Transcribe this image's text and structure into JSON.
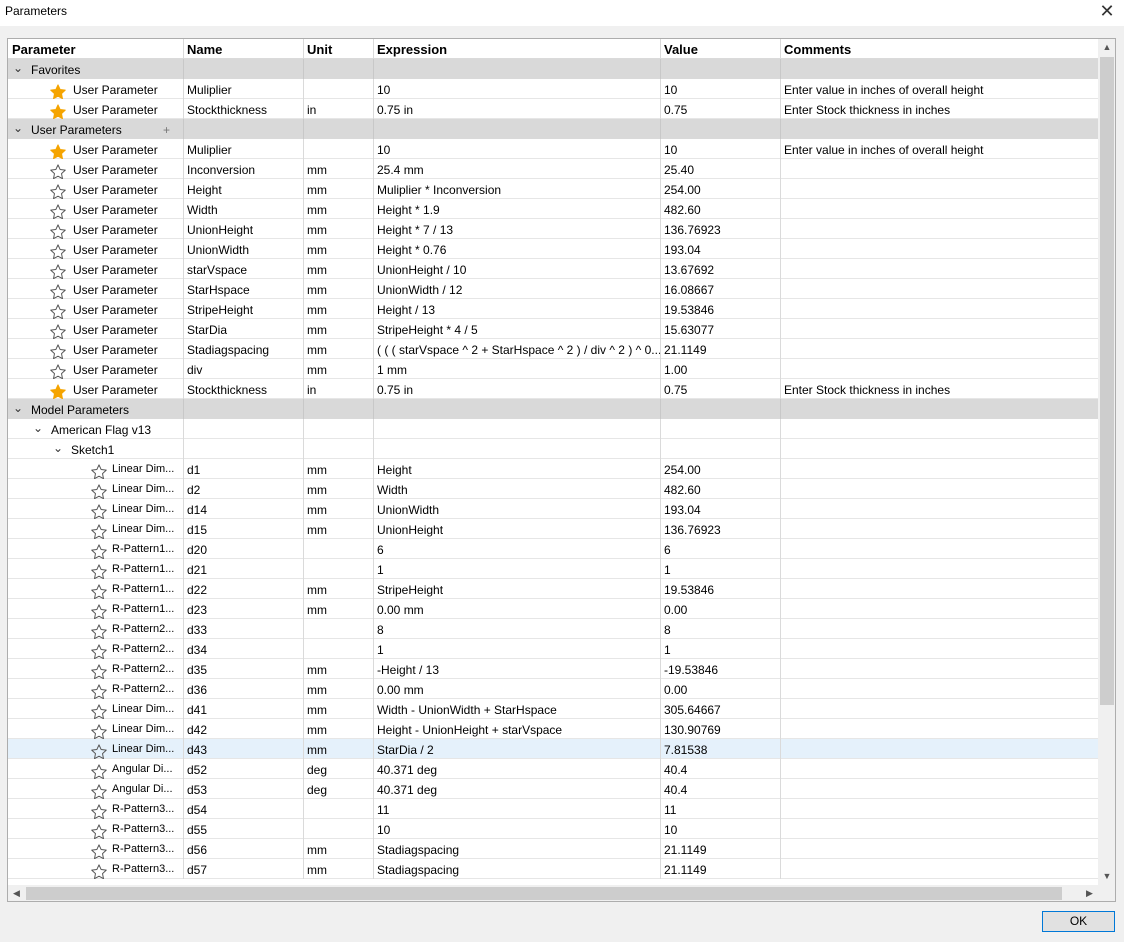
{
  "window": {
    "title": "Parameters"
  },
  "columns": [
    "Parameter",
    "Name",
    "Unit",
    "Expression",
    "Value",
    "Comments"
  ],
  "colors": {
    "star_fav": "#f5a400",
    "selected_row": "#e5f1fb",
    "group_bg": "#d9d9d9"
  },
  "rows": [
    {
      "type": "group",
      "indent": 0,
      "label": "Favorites",
      "plus": false
    },
    {
      "type": "user",
      "fav": true,
      "param": "User Parameter",
      "name": "Muliplier",
      "unit": "",
      "expr": "10",
      "value": "10",
      "comment": "Enter value in inches of overall height"
    },
    {
      "type": "user",
      "fav": true,
      "param": "User Parameter",
      "name": "Stockthickness",
      "unit": "in",
      "expr": "0.75 in",
      "value": "0.75",
      "comment": "Enter Stock thickness in inches"
    },
    {
      "type": "group",
      "indent": 0,
      "label": "User Parameters",
      "plus": true
    },
    {
      "type": "user",
      "fav": true,
      "param": "User Parameter",
      "name": "Muliplier",
      "unit": "",
      "expr": "10",
      "value": "10",
      "comment": "Enter value in inches of overall height"
    },
    {
      "type": "user",
      "fav": false,
      "param": "User Parameter",
      "name": "Inconversion",
      "unit": "mm",
      "expr": "25.4 mm",
      "value": "25.40",
      "comment": ""
    },
    {
      "type": "user",
      "fav": false,
      "param": "User Parameter",
      "name": "Height",
      "unit": "mm",
      "expr": "Muliplier * Inconversion",
      "value": "254.00",
      "comment": ""
    },
    {
      "type": "user",
      "fav": false,
      "param": "User Parameter",
      "name": "Width",
      "unit": "mm",
      "expr": "Height * 1.9",
      "value": "482.60",
      "comment": ""
    },
    {
      "type": "user",
      "fav": false,
      "param": "User Parameter",
      "name": "UnionHeight",
      "unit": "mm",
      "expr": "Height * 7 / 13",
      "value": "136.76923",
      "comment": ""
    },
    {
      "type": "user",
      "fav": false,
      "param": "User Parameter",
      "name": "UnionWidth",
      "unit": "mm",
      "expr": "Height * 0.76",
      "value": "193.04",
      "comment": ""
    },
    {
      "type": "user",
      "fav": false,
      "param": "User Parameter",
      "name": "starVspace",
      "unit": "mm",
      "expr": "UnionHeight / 10",
      "value": "13.67692",
      "comment": ""
    },
    {
      "type": "user",
      "fav": false,
      "param": "User Parameter",
      "name": "StarHspace",
      "unit": "mm",
      "expr": "UnionWidth / 12",
      "value": "16.08667",
      "comment": ""
    },
    {
      "type": "user",
      "fav": false,
      "param": "User Parameter",
      "name": "StripeHeight",
      "unit": "mm",
      "expr": "Height / 13",
      "value": "19.53846",
      "comment": ""
    },
    {
      "type": "user",
      "fav": false,
      "param": "User Parameter",
      "name": "StarDia",
      "unit": "mm",
      "expr": "StripeHeight * 4 / 5",
      "value": "15.63077",
      "comment": ""
    },
    {
      "type": "user",
      "fav": false,
      "param": "User Parameter",
      "name": "Stadiagspacing",
      "unit": "mm",
      "expr": "( ( ( starVspace ^ 2 + StarHspace ^ 2 ) / div ^ 2 ) ^ 0...",
      "value": "21.1149",
      "comment": ""
    },
    {
      "type": "user",
      "fav": false,
      "param": "User Parameter",
      "name": "div",
      "unit": "mm",
      "expr": "1 mm",
      "value": "1.00",
      "comment": ""
    },
    {
      "type": "user",
      "fav": true,
      "param": "User Parameter",
      "name": "Stockthickness",
      "unit": "in",
      "expr": "0.75 in",
      "value": "0.75",
      "comment": "Enter Stock thickness in inches"
    },
    {
      "type": "group",
      "indent": 0,
      "label": "Model Parameters",
      "plus": false
    },
    {
      "type": "tree",
      "indent": 1,
      "label": "American Flag v13"
    },
    {
      "type": "tree",
      "indent": 2,
      "label": "Sketch1"
    },
    {
      "type": "model",
      "param": "Linear Dim...",
      "name": "d1",
      "unit": "mm",
      "expr": "Height",
      "value": "254.00"
    },
    {
      "type": "model",
      "param": "Linear Dim...",
      "name": "d2",
      "unit": "mm",
      "expr": "Width",
      "value": "482.60"
    },
    {
      "type": "model",
      "param": "Linear Dim...",
      "name": "d14",
      "unit": "mm",
      "expr": "UnionWidth",
      "value": "193.04"
    },
    {
      "type": "model",
      "param": "Linear Dim...",
      "name": "d15",
      "unit": "mm",
      "expr": "UnionHeight",
      "value": "136.76923"
    },
    {
      "type": "model",
      "param": "R-Pattern1...",
      "name": "d20",
      "unit": "",
      "expr": "6",
      "value": "6"
    },
    {
      "type": "model",
      "param": "R-Pattern1...",
      "name": "d21",
      "unit": "",
      "expr": "1",
      "value": "1"
    },
    {
      "type": "model",
      "param": "R-Pattern1...",
      "name": "d22",
      "unit": "mm",
      "expr": "StripeHeight",
      "value": "19.53846"
    },
    {
      "type": "model",
      "param": "R-Pattern1...",
      "name": "d23",
      "unit": "mm",
      "expr": "0.00 mm",
      "value": "0.00"
    },
    {
      "type": "model",
      "param": "R-Pattern2...",
      "name": "d33",
      "unit": "",
      "expr": "8",
      "value": "8"
    },
    {
      "type": "model",
      "param": "R-Pattern2...",
      "name": "d34",
      "unit": "",
      "expr": "1",
      "value": "1"
    },
    {
      "type": "model",
      "param": "R-Pattern2...",
      "name": "d35",
      "unit": "mm",
      "expr": "-Height / 13",
      "value": "-19.53846"
    },
    {
      "type": "model",
      "param": "R-Pattern2...",
      "name": "d36",
      "unit": "mm",
      "expr": "0.00 mm",
      "value": "0.00"
    },
    {
      "type": "model",
      "param": "Linear Dim...",
      "name": "d41",
      "unit": "mm",
      "expr": "Width - UnionWidth + StarHspace",
      "value": "305.64667"
    },
    {
      "type": "model",
      "param": "Linear Dim...",
      "name": "d42",
      "unit": "mm",
      "expr": "Height - UnionHeight + starVspace",
      "value": "130.90769"
    },
    {
      "type": "model",
      "param": "Linear Dim...",
      "name": "d43",
      "unit": "mm",
      "expr": "StarDia / 2",
      "value": "7.81538",
      "selected": true
    },
    {
      "type": "model",
      "param": "Angular Di...",
      "name": "d52",
      "unit": "deg",
      "expr": "40.371 deg",
      "value": "40.4"
    },
    {
      "type": "model",
      "param": "Angular Di...",
      "name": "d53",
      "unit": "deg",
      "expr": "40.371 deg",
      "value": "40.4"
    },
    {
      "type": "model",
      "param": "R-Pattern3...",
      "name": "d54",
      "unit": "",
      "expr": "11",
      "value": "11"
    },
    {
      "type": "model",
      "param": "R-Pattern3...",
      "name": "d55",
      "unit": "",
      "expr": "10",
      "value": "10"
    },
    {
      "type": "model",
      "param": "R-Pattern3...",
      "name": "d56",
      "unit": "mm",
      "expr": "Stadiagspacing",
      "value": "21.1149"
    },
    {
      "type": "model",
      "param": "R-Pattern3...",
      "name": "d57",
      "unit": "mm",
      "expr": "Stadiagspacing",
      "value": "21.1149"
    }
  ],
  "footer": {
    "ok_label": "OK"
  }
}
